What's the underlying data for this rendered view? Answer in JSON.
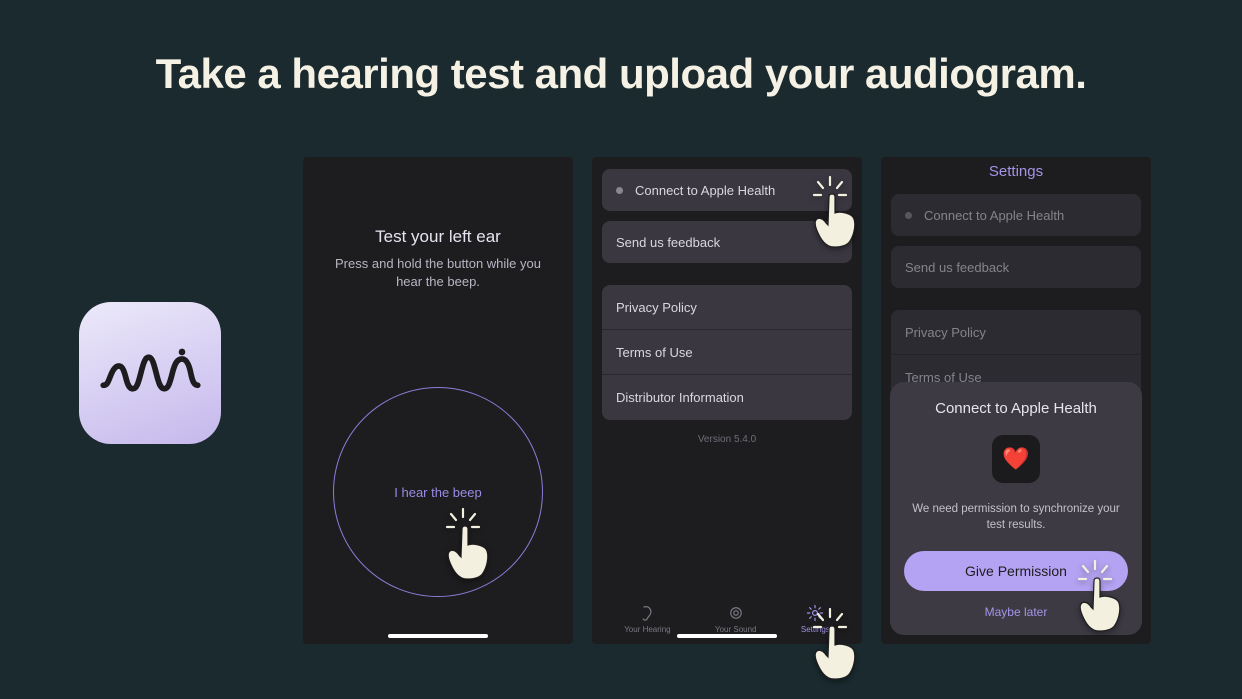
{
  "headline": "Take a hearing test and upload your audiogram.",
  "app": {
    "name": "mimi"
  },
  "screen1": {
    "title": "Test your left ear",
    "subtitle": "Press and hold the button while you hear the beep.",
    "button": "I hear the beep"
  },
  "settings": {
    "title": "Settings",
    "connect": "Connect to Apple Health",
    "feedback": "Send us feedback",
    "privacy": "Privacy Policy",
    "terms": "Terms of Use",
    "distributor": "Distributor Information",
    "version": "Version 5.4.0",
    "tabs": {
      "hearing": "Your Hearing",
      "sound": "Your Sound",
      "settings": "Settings"
    }
  },
  "modal": {
    "title": "Connect to Apple Health",
    "description": "We need permission to synchronize your test results.",
    "allow": "Give Permission",
    "later": "Maybe later",
    "heart": "❤️"
  }
}
